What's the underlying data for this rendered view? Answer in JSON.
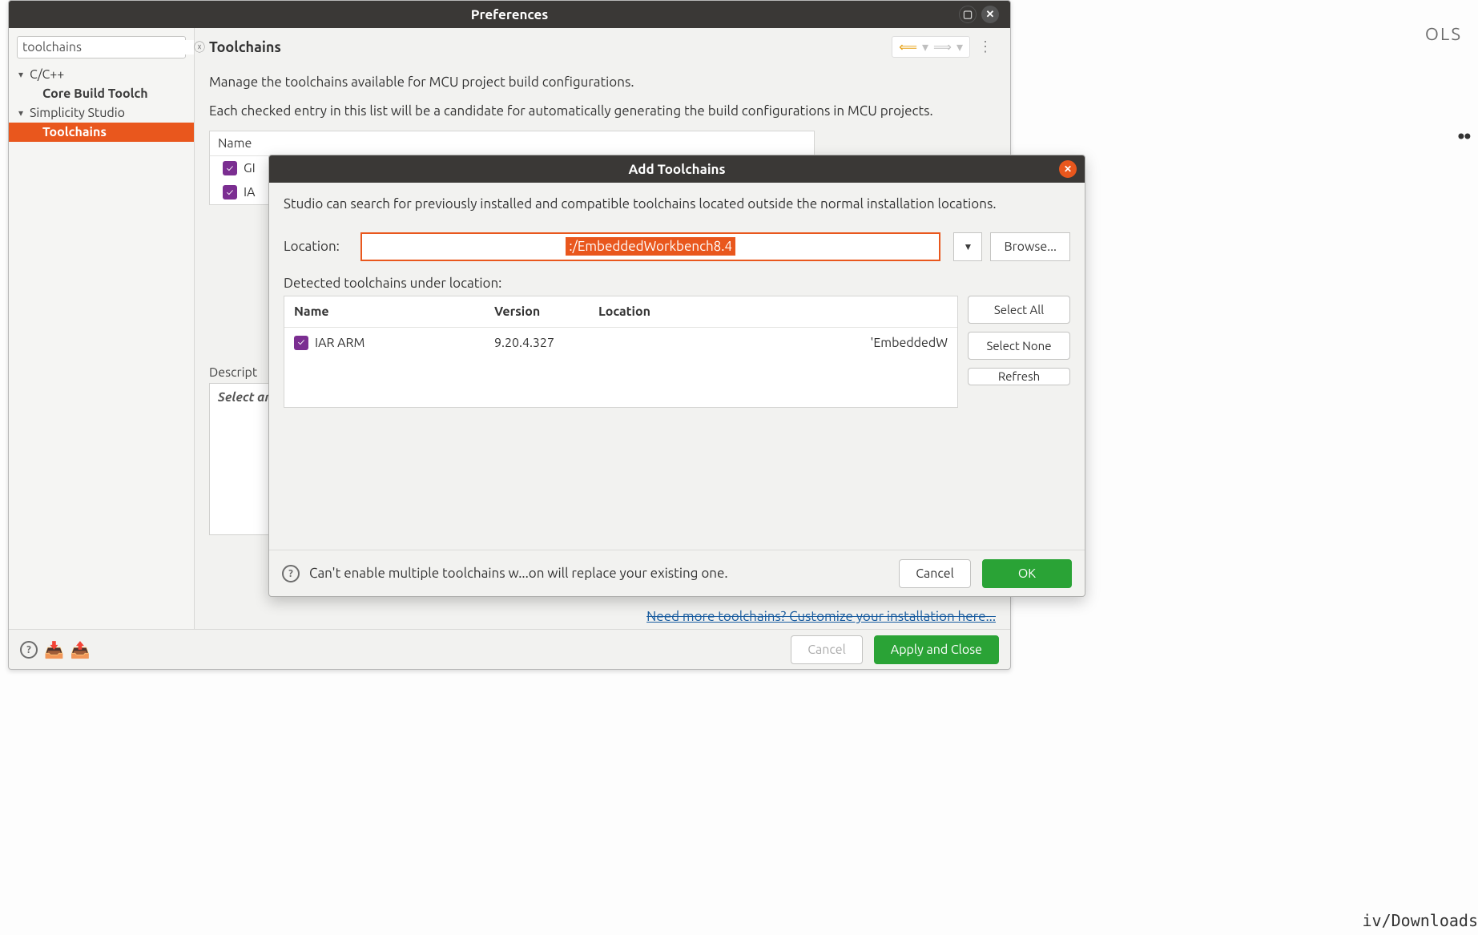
{
  "background": {
    "ols": "OLS",
    "dots": "••",
    "path": "iv/Downloads"
  },
  "pref": {
    "title": "Preferences",
    "search": "toolchains",
    "tree": {
      "cpp": "C/C++",
      "core": "Core Build Toolch",
      "studio": "Simplicity Studio",
      "toolchains": "Toolchains"
    },
    "panel_title": "Toolchains",
    "desc1": "Manage the toolchains available for MCU project build configurations.",
    "desc2": "Each checked entry in this list will be a candidate for automatically generating the build configurations in MCU projects.",
    "table": {
      "name_hdr": "Name",
      "rows": [
        "GI",
        "IA"
      ]
    },
    "description_lbl": "Descript",
    "description_placeholder": "Select ar",
    "need_link": "Need more toolchains?  Customize your installation here...",
    "cancel": "Cancel",
    "apply": "Apply and Close"
  },
  "add": {
    "title": "Add Toolchains",
    "desc": "Studio can search for previously installed and compatible toolchains located outside the normal installation locations.",
    "location_lbl": "Location:",
    "location_val": ":/EmbeddedWorkbench8.4",
    "browse": "Browse...",
    "detected_lbl": "Detected toolchains under location:",
    "cols": {
      "name": "Name",
      "version": "Version",
      "location": "Location"
    },
    "rows": [
      {
        "name": "IAR ARM",
        "version": "9.20.4.327",
        "location": "'EmbeddedW"
      }
    ],
    "select_all": "Select All",
    "select_none": "Select None",
    "refresh": "Refresh",
    "warn": "Can't enable multiple toolchains w...on will replace your existing one.",
    "cancel": "Cancel",
    "ok": "OK"
  }
}
